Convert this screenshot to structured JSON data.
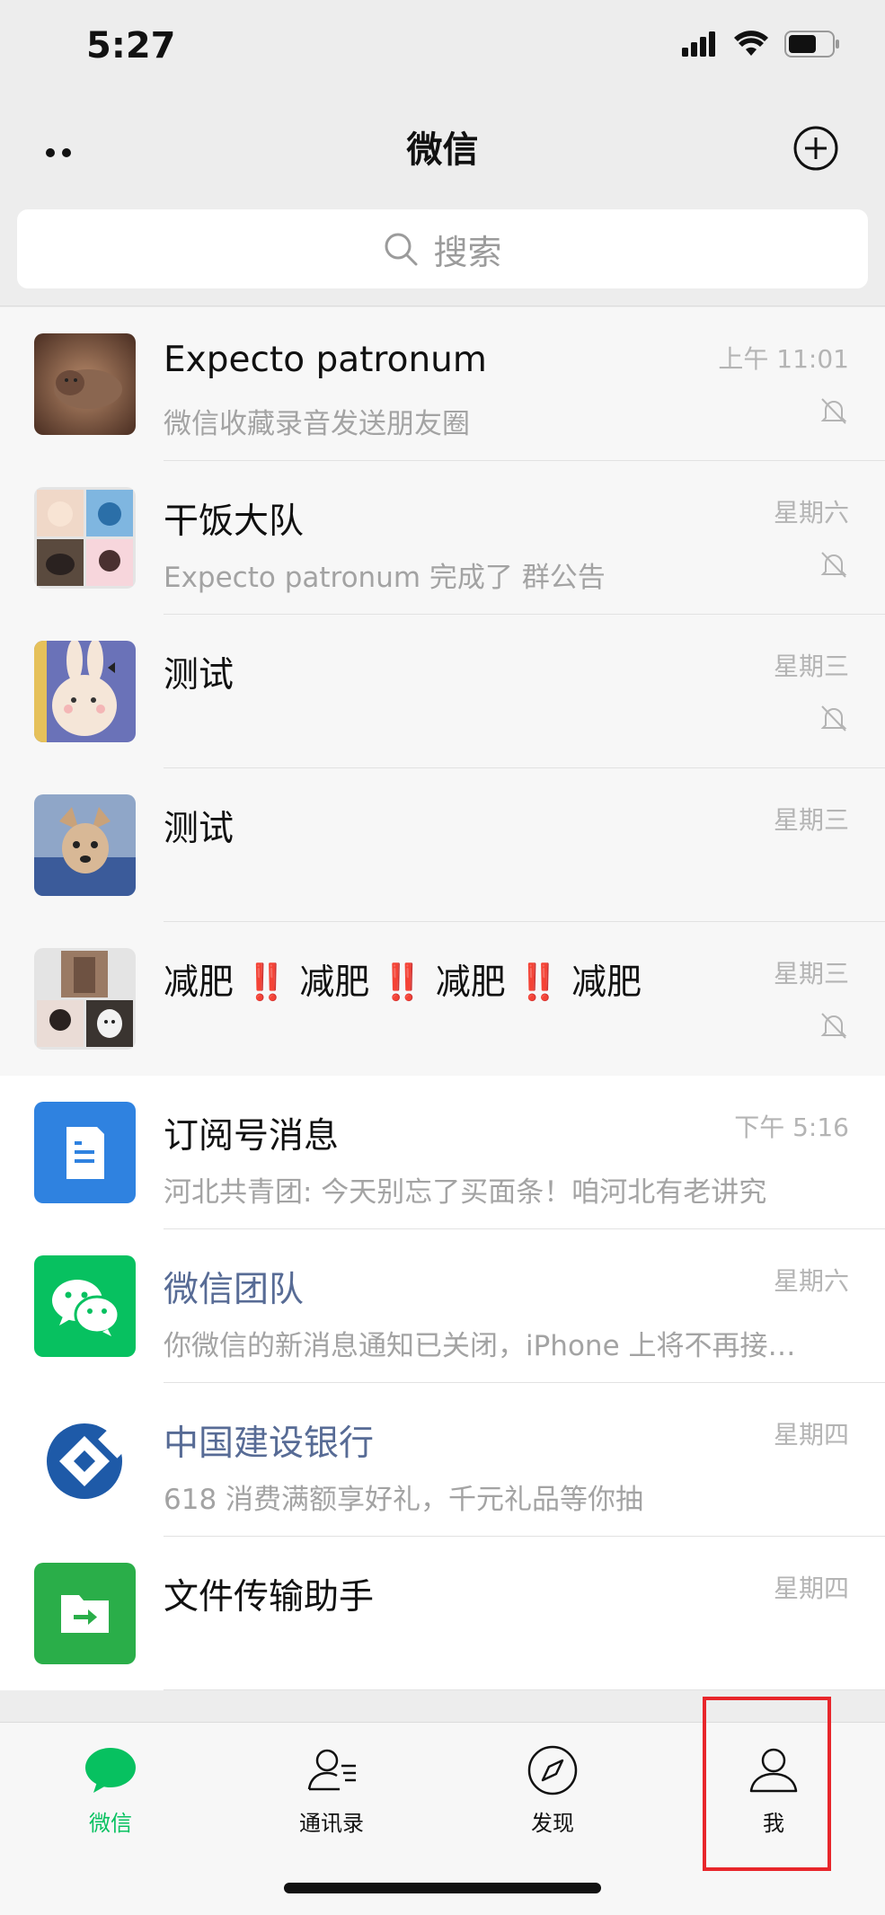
{
  "status_bar": {
    "time": "5:27"
  },
  "nav": {
    "title": "微信"
  },
  "search": {
    "placeholder": "搜索"
  },
  "chats": [
    {
      "name": "Expecto patronum",
      "preview": "微信收藏录音发送朋友圈",
      "time": "上午 11:01",
      "muted": true,
      "pinned": true
    },
    {
      "name": "干饭大队",
      "preview": "Expecto patronum 完成了 群公告",
      "time": "星期六",
      "muted": true,
      "pinned": true
    },
    {
      "name": "测试",
      "preview": "",
      "time": "星期三",
      "muted": true,
      "pinned": true
    },
    {
      "name": "测试",
      "preview": "",
      "time": "星期三",
      "muted": false,
      "pinned": true
    },
    {
      "name_parts": [
        "减肥",
        "‼️",
        "减肥",
        "‼️",
        "减肥",
        "‼️",
        "减肥"
      ],
      "preview": "",
      "time": "星期三",
      "muted": true,
      "pinned": true
    },
    {
      "name": "订阅号消息",
      "preview": "河北共青团: 今天别忘了买面条！咱河北有老讲究",
      "time": "下午 5:16",
      "muted": false,
      "pinned": false
    },
    {
      "name": "微信团队",
      "preview": "你微信的新消息通知已关闭，iPhone 上将不再接…",
      "time": "星期六",
      "muted": false,
      "pinned": false,
      "official": true
    },
    {
      "name": "中国建设银行",
      "preview": "618 消费满额享好礼，千元礼品等你抽",
      "time": "星期四",
      "muted": false,
      "pinned": false,
      "official": true
    },
    {
      "name": "文件传输助手",
      "preview": "",
      "time": "星期四",
      "muted": false,
      "pinned": false
    }
  ],
  "tabs": [
    {
      "label": "微信",
      "icon": "chat-bubble-icon",
      "active": true
    },
    {
      "label": "通讯录",
      "icon": "contacts-icon",
      "active": false
    },
    {
      "label": "发现",
      "icon": "compass-icon",
      "active": false
    },
    {
      "label": "我",
      "icon": "person-icon",
      "active": false
    }
  ],
  "colors": {
    "accent": "#07c160",
    "official_name": "#576b95",
    "highlight": "#e8262b"
  }
}
